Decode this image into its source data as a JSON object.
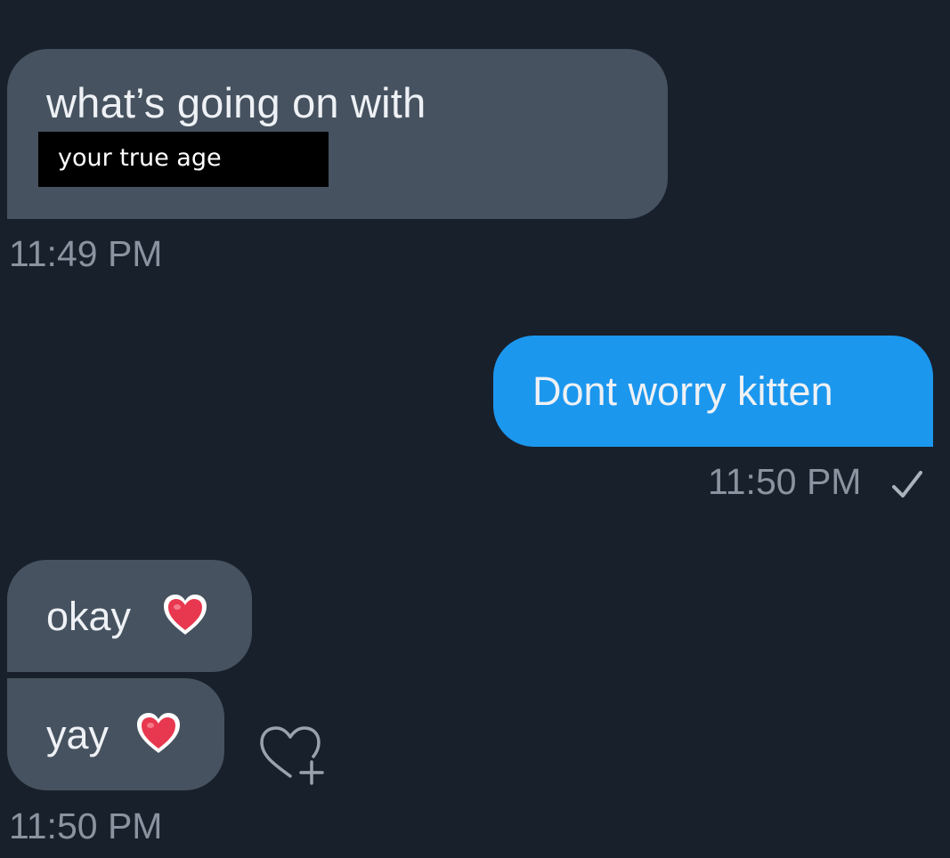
{
  "messages": [
    {
      "id": "m1",
      "direction": "received",
      "text": "what’s going on with",
      "redaction_label": "your true age"
    },
    {
      "id": "m2",
      "direction": "sent",
      "text": "Dont worry kitten"
    },
    {
      "id": "m3",
      "direction": "received",
      "text": "okay",
      "emoji": "red-heart"
    },
    {
      "id": "m4",
      "direction": "received",
      "text": "yay",
      "emoji": "red-heart"
    }
  ],
  "timestamps": {
    "first": "11:49 PM",
    "sent": "11:50 PM",
    "last": "11:50 PM"
  },
  "status": {
    "sent_icon": "check-icon"
  },
  "actions": {
    "react_icon": "add-reaction-heart-icon"
  },
  "colors": {
    "background": "#18202b",
    "received_bubble": "#46525f",
    "sent_bubble": "#1c97ee",
    "text": "#eef1f5",
    "timestamp": "#8a94a0",
    "heart": "#e8384f"
  }
}
